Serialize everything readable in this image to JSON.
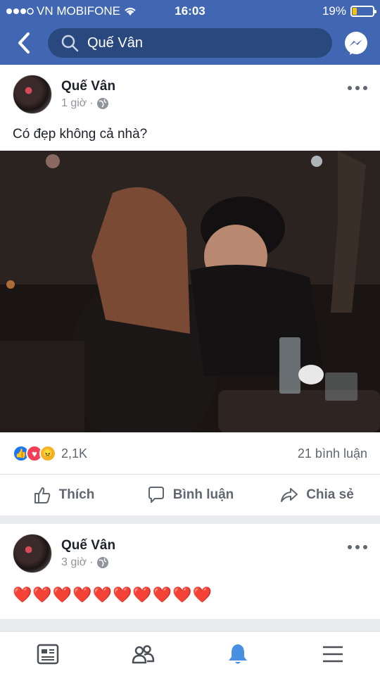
{
  "status": {
    "carrier": "VN MOBIFONE",
    "time": "16:03",
    "battery": "19%",
    "battery_level": 0.19
  },
  "search": {
    "value": "Quế Vân"
  },
  "posts": [
    {
      "name": "Quế Vân",
      "time": "1 giờ",
      "separator": "·",
      "text": "Có đẹp không cả nhà?",
      "reaction_count": "2,1K",
      "comment_count": "21 bình luận"
    },
    {
      "name": "Quế Vân",
      "time": "3 giờ",
      "separator": "·",
      "text": "❤️❤️❤️❤️❤️❤️❤️❤️❤️❤️"
    }
  ],
  "actions": {
    "like": "Thích",
    "comment": "Bình luận",
    "share": "Chia sẻ"
  },
  "colors": {
    "brand": "#4267b2",
    "like_blue": "#1877f2",
    "heart_red": "#f33e58",
    "angry_orange": "#f7b125"
  },
  "icons": [
    "wifi-icon",
    "back-icon",
    "search-icon",
    "messenger-icon",
    "globe-icon",
    "more-icon",
    "like-icon",
    "comment-icon",
    "share-icon",
    "news-feed-icon",
    "friends-icon",
    "notifications-icon",
    "menu-icon"
  ]
}
